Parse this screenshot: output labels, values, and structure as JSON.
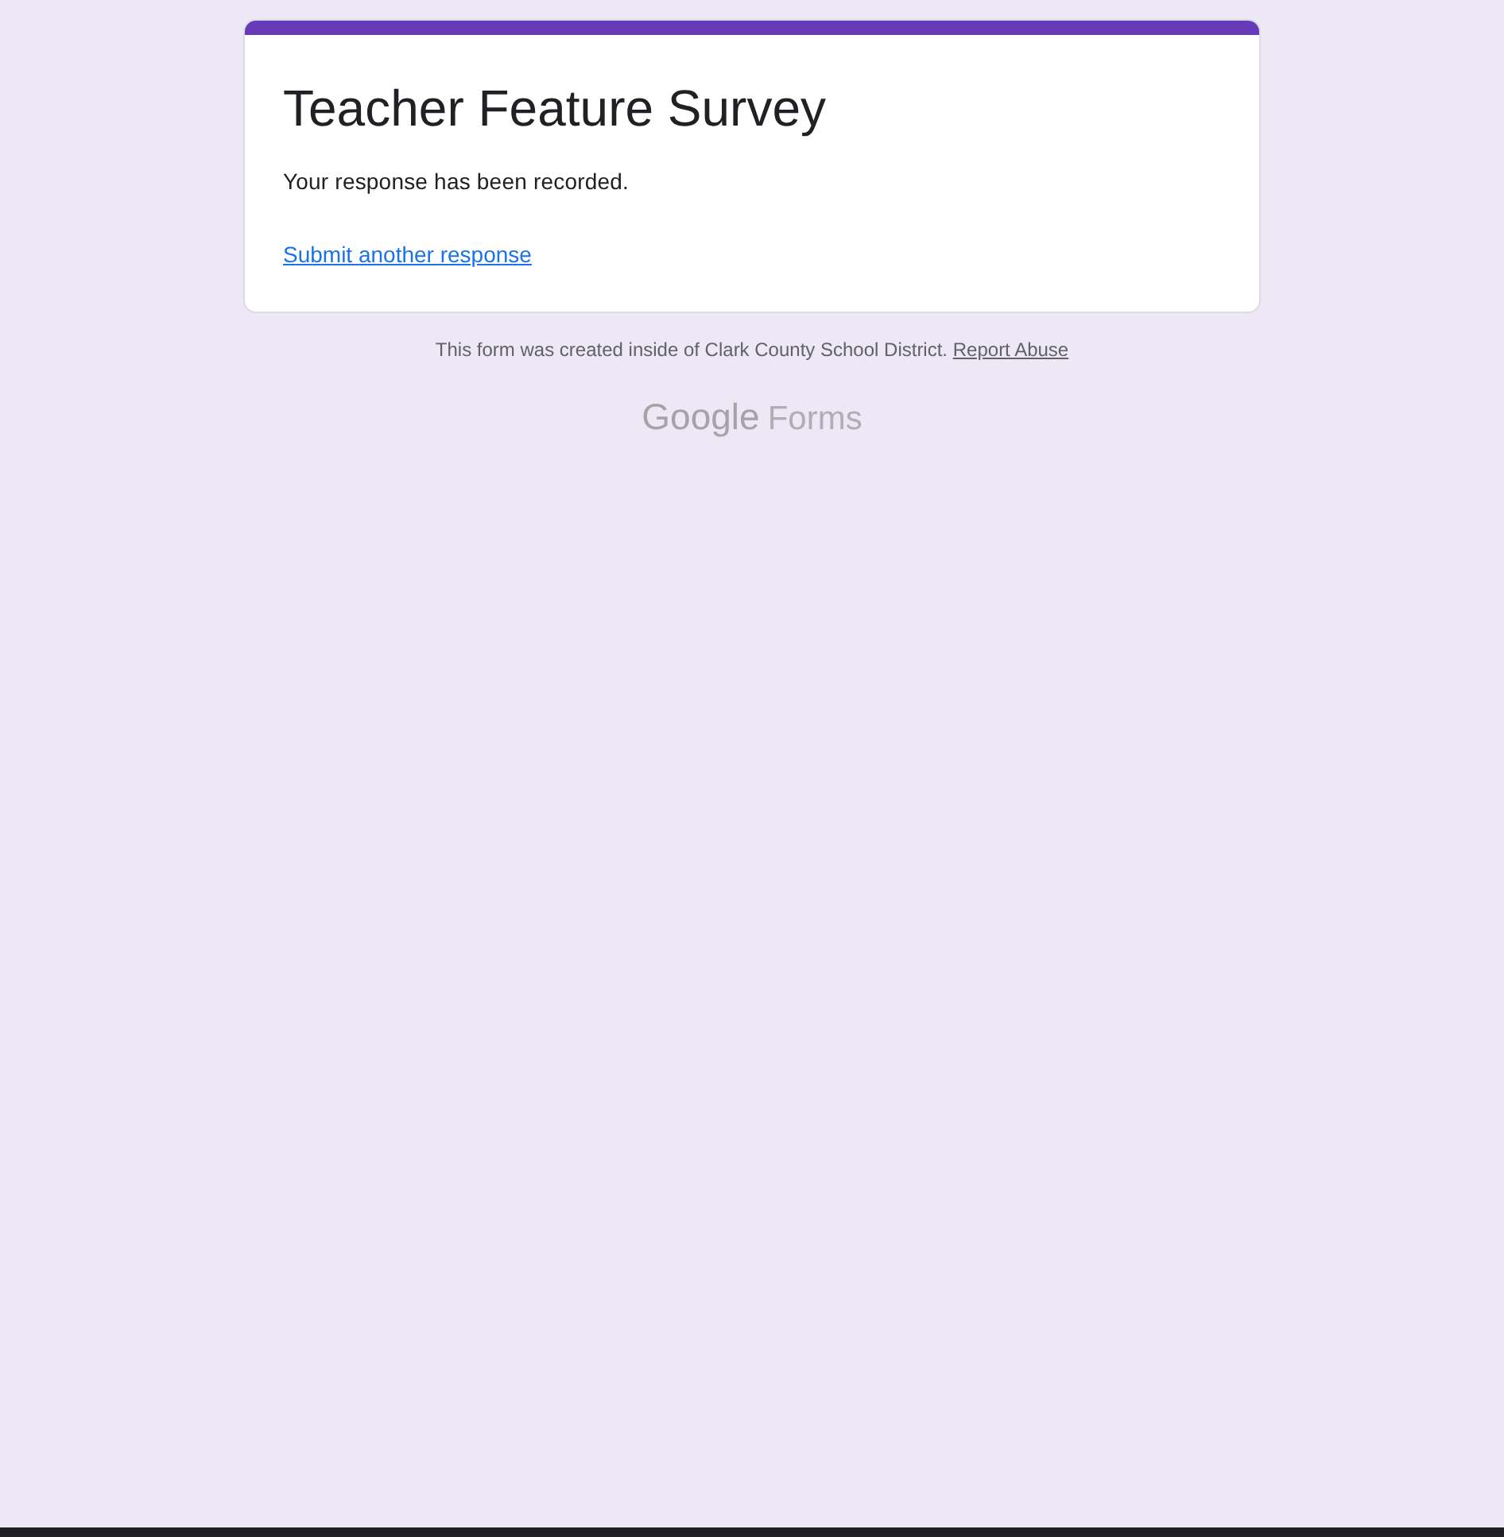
{
  "form": {
    "title": "Teacher Feature Survey",
    "confirmation": "Your response has been recorded.",
    "link": "Submit another response"
  },
  "footer": {
    "notice": "This form was created inside of Clark County School District.",
    "link": "Report Abuse"
  },
  "logo": {
    "brand": "Google",
    "product": "Forms"
  }
}
